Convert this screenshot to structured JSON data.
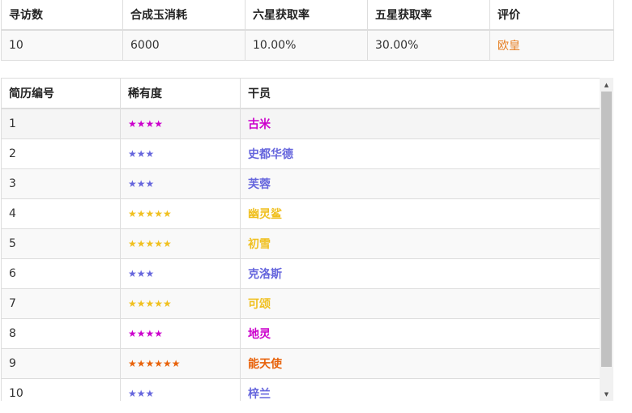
{
  "summary": {
    "headers": [
      "寻访数",
      "合成玉消耗",
      "六星获取率",
      "五星获取率",
      "评价"
    ],
    "values": [
      "10",
      "6000",
      "10.00%",
      "30.00%",
      "欧皇"
    ],
    "rating_color": "#e67e22"
  },
  "roster": {
    "headers": [
      "简历编号",
      "稀有度",
      "干员"
    ],
    "rows": [
      {
        "id": "1",
        "stars": "★★★★",
        "name": "古米",
        "color": "#cc00cc"
      },
      {
        "id": "2",
        "stars": "★★★",
        "name": "史都华德",
        "color": "#6666dd"
      },
      {
        "id": "3",
        "stars": "★★★",
        "name": "芙蓉",
        "color": "#6666dd"
      },
      {
        "id": "4",
        "stars": "★★★★★",
        "name": "幽灵鲨",
        "color": "#f0c020"
      },
      {
        "id": "5",
        "stars": "★★★★★",
        "name": "初雪",
        "color": "#f0c020"
      },
      {
        "id": "6",
        "stars": "★★★",
        "name": "克洛斯",
        "color": "#6666dd"
      },
      {
        "id": "7",
        "stars": "★★★★★",
        "name": "可颂",
        "color": "#f0c020"
      },
      {
        "id": "8",
        "stars": "★★★★",
        "name": "地灵",
        "color": "#cc00cc"
      },
      {
        "id": "9",
        "stars": "★★★★★★",
        "name": "能天使",
        "color": "#e8620a"
      },
      {
        "id": "10",
        "stars": "★★★",
        "name": "梓兰",
        "color": "#6666dd"
      }
    ]
  },
  "scrollbar": {
    "up_icon": "▲",
    "down_icon": "▼"
  }
}
